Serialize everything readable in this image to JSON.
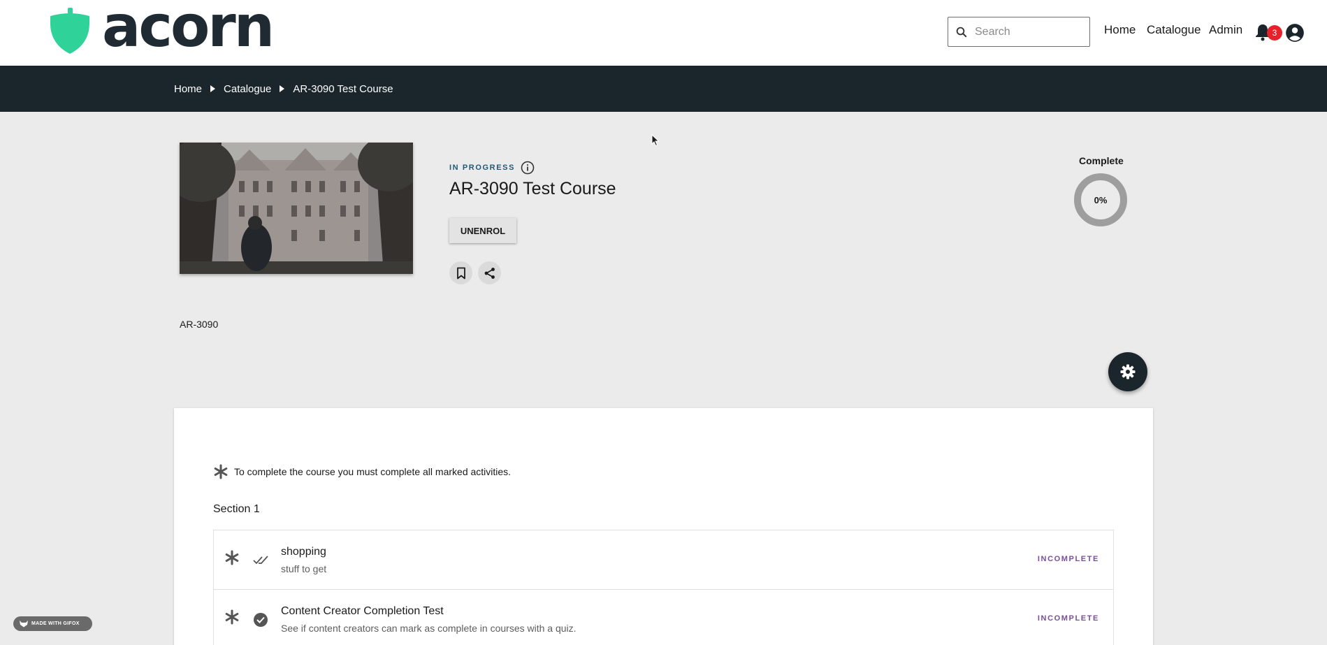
{
  "brand": {
    "name": "acorn",
    "color": "#2fd39a"
  },
  "header": {
    "search_placeholder": "Search",
    "nav": {
      "home": "Home",
      "catalogue": "Catalogue",
      "admin": "Admin"
    },
    "notification_count": "3"
  },
  "breadcrumb": [
    "Home",
    "Catalogue",
    "AR-3090 Test Course"
  ],
  "course": {
    "status": "IN PROGRESS",
    "title": "AR-3090 Test Course",
    "unenrol_label": "UNENROL",
    "code": "AR-3090",
    "complete_label": "Complete",
    "progress_text": "0%",
    "progress_fraction": 0
  },
  "content": {
    "requirement_note": "To complete the course you must complete all marked activities.",
    "section_title": "Section 1",
    "activities": [
      {
        "title": "shopping",
        "subtitle": "stuff to get",
        "status": "INCOMPLETE",
        "icon": "double-check-icon"
      },
      {
        "title": "Content Creator Completion Test",
        "subtitle": "See if content creators can mark as complete in courses with a quiz.",
        "status": "INCOMPLETE",
        "icon": "check-circle-icon"
      }
    ]
  },
  "watermark": "MADE WITH GIFOX",
  "colors": {
    "dark_bar": "#1b252c",
    "status_blue": "#1f5a73",
    "incomplete_purple": "#7a4f9a",
    "badge_red": "#e8202a"
  }
}
